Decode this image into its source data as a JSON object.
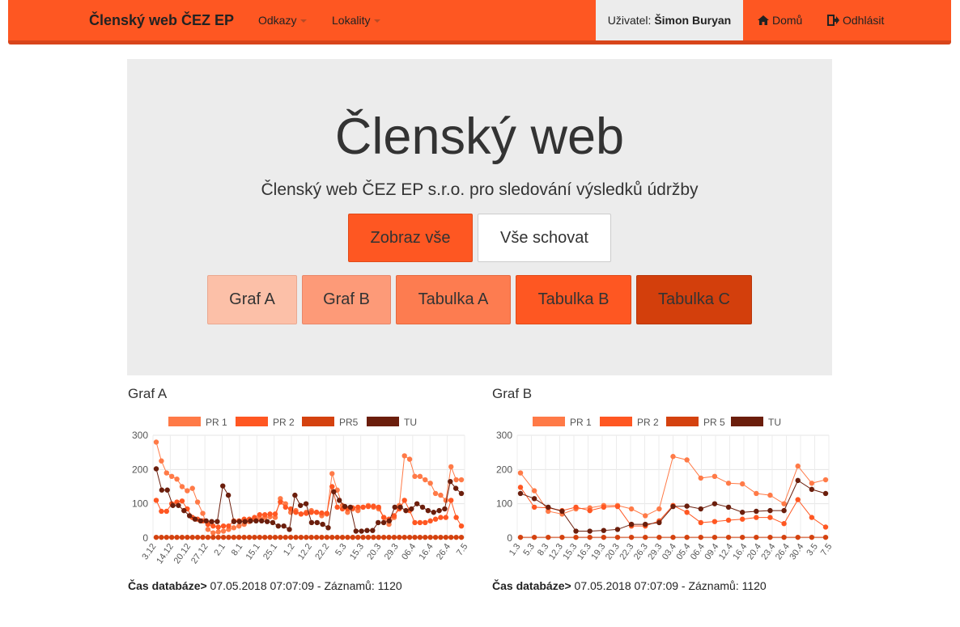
{
  "navbar": {
    "brand": "Členský web ČEZ EP",
    "menu_odkazy": "Odkazy",
    "menu_lokality": "Lokality",
    "user_label": "Uživatel:",
    "user_name": "Šimon Buryan",
    "home": "Domů",
    "logout": "Odhlásit"
  },
  "hero": {
    "title": "Členský web",
    "subtitle": "Členský web ČEZ EP s.r.o. pro sledování výsledků údržby",
    "show_all": "Zobraz vše",
    "hide_all": "Vše schovat",
    "graf_a": "Graf A",
    "graf_b": "Graf B",
    "tabulka_a": "Tabulka A",
    "tabulka_b": "Tabulka B",
    "tabulka_c": "Tabulka C"
  },
  "panels": {
    "a_title": "Graf A",
    "b_title": "Graf B",
    "footer_label": "Čas databáze>",
    "footer_value": " 07.05.2018 07:07:09 - Záznamů: 1120"
  },
  "colors": {
    "brand": "#fe5722",
    "pr1": "#ff7a47",
    "pr2": "#ff5722",
    "pr5": "#d4420f",
    "tu": "#6b1e0c"
  },
  "chart_data": [
    {
      "type": "line",
      "ylim": [
        0,
        300
      ],
      "yticks": [
        0,
        100,
        200,
        300
      ],
      "grid": true,
      "legend": "top",
      "x_tick_labels": [
        "3.12",
        "14.12",
        "20.12",
        "27.12",
        "2.1",
        "8.1",
        "15.1",
        "25.1",
        "1.2",
        "12.2",
        "22.2",
        "5.3",
        "15.3",
        "20.3",
        "29.3",
        "06.4",
        "16.4",
        "26.4",
        "7.5"
      ],
      "series": [
        {
          "name": "PR 1",
          "color": "#ff7a47",
          "values": [
            280,
            225,
            190,
            180,
            172,
            150,
            138,
            145,
            105,
            72,
            25,
            15,
            18,
            20,
            25,
            30,
            35,
            40,
            48,
            55,
            58,
            60,
            62,
            60,
            115,
            100,
            75,
            80,
            70,
            75,
            80,
            75,
            65,
            70,
            188,
            140,
            95,
            75,
            85,
            80,
            90,
            95,
            90,
            85,
            60,
            40,
            60,
            95,
            240,
            230,
            180,
            180,
            170,
            160,
            130,
            125,
            110,
            208,
            170,
            170
          ]
        },
        {
          "name": "PR 2",
          "color": "#ff5722",
          "values": [
            110,
            78,
            78,
            100,
            105,
            108,
            85,
            60,
            55,
            50,
            40,
            35,
            32,
            35,
            35,
            50,
            50,
            55,
            55,
            60,
            68,
            68,
            70,
            70,
            105,
            90,
            85,
            75,
            70,
            72,
            75,
            75,
            73,
            72,
            150,
            90,
            85,
            85,
            88,
            90,
            90,
            92,
            93,
            90,
            60,
            55,
            65,
            85,
            110,
            80,
            45,
            45,
            45,
            50,
            55,
            60,
            60,
            110,
            60,
            35
          ]
        },
        {
          "name": "PR5",
          "color": "#d4420f",
          "values": [
            2,
            2,
            2,
            2,
            2,
            2,
            2,
            2,
            2,
            2,
            2,
            2,
            2,
            2,
            2,
            2,
            2,
            2,
            2,
            2,
            2,
            2,
            2,
            2,
            2,
            2,
            2,
            2,
            2,
            2,
            2,
            2,
            2,
            2,
            2,
            2,
            2,
            2,
            2,
            2,
            2,
            2,
            2,
            2,
            2,
            2,
            2,
            2,
            2,
            2,
            2,
            2,
            2,
            2,
            2,
            2,
            2,
            2,
            2,
            2
          ]
        },
        {
          "name": "TU",
          "color": "#6b1e0c",
          "values": [
            202,
            140,
            140,
            95,
            95,
            80,
            65,
            55,
            50,
            50,
            48,
            48,
            152,
            125,
            48,
            48,
            48,
            50,
            50,
            50,
            48,
            45,
            35,
            35,
            25,
            125,
            95,
            100,
            45,
            45,
            40,
            30,
            135,
            110,
            92,
            90,
            20,
            20,
            22,
            22,
            45,
            45,
            50,
            90,
            90,
            80,
            85,
            100,
            90,
            80,
            75,
            80,
            85,
            165,
            145,
            130
          ]
        }
      ]
    },
    {
      "type": "line",
      "ylim": [
        0,
        300
      ],
      "yticks": [
        0,
        100,
        200,
        300
      ],
      "grid": true,
      "legend": "top",
      "x_tick_labels": [
        "1.3",
        "5.3",
        "8.3",
        "12.3",
        "15.3",
        "16.3",
        "19.3",
        "20.3",
        "22.3",
        "26.3",
        "29.3",
        "03.4",
        "05.4",
        "06.4",
        "09.4",
        "12.4",
        "16.4",
        "20.4",
        "23.4",
        "26.4",
        "30.4",
        "3.5",
        "7.5"
      ],
      "series": [
        {
          "name": "PR 1",
          "color": "#ff7a47",
          "values": [
            190,
            138,
            78,
            70,
            85,
            88,
            95,
            95,
            85,
            65,
            85,
            238,
            228,
            175,
            180,
            160,
            158,
            130,
            125,
            100,
            210,
            160,
            170
          ]
        },
        {
          "name": "PR 2",
          "color": "#ff5722",
          "values": [
            148,
            90,
            88,
            80,
            90,
            80,
            90,
            92,
            35,
            35,
            50,
            95,
            75,
            45,
            48,
            52,
            55,
            60,
            60,
            42,
            112,
            60,
            32
          ]
        },
        {
          "name": "PR 5",
          "color": "#d4420f",
          "values": [
            2,
            2,
            2,
            2,
            2,
            2,
            2,
            2,
            2,
            2,
            2,
            2,
            2,
            2,
            2,
            2,
            2,
            2,
            2,
            2,
            2,
            2,
            2
          ]
        },
        {
          "name": "TU",
          "color": "#6b1e0c",
          "values": [
            130,
            115,
            90,
            78,
            20,
            20,
            22,
            25,
            40,
            40,
            45,
            92,
            93,
            85,
            100,
            90,
            75,
            78,
            80,
            80,
            168,
            142,
            130
          ]
        }
      ]
    }
  ]
}
